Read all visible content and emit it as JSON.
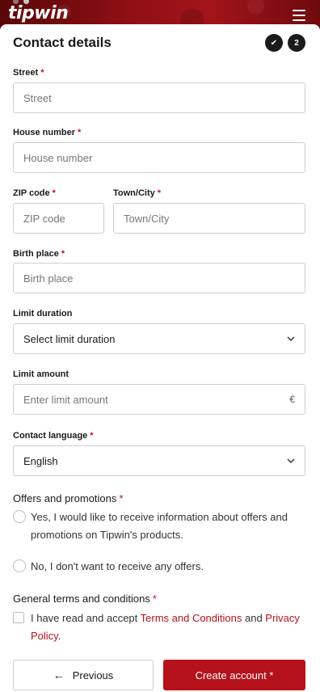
{
  "header": {
    "logo": "tipwin",
    "menu_icon": "hamburger-menu-icon"
  },
  "form": {
    "title": "Contact details",
    "steps": [
      "✔",
      "2"
    ],
    "street": {
      "label": "Street",
      "required": "*",
      "placeholder": "Street"
    },
    "house_number": {
      "label": "House number",
      "required": "*",
      "placeholder": "House number"
    },
    "zip": {
      "label": "ZIP code",
      "required": "*",
      "placeholder": "ZIP code"
    },
    "city": {
      "label": "Town/City",
      "required": "*",
      "placeholder": "Town/City"
    },
    "birth_place": {
      "label": "Birth place",
      "required": "*",
      "placeholder": "Birth place"
    },
    "limit_duration": {
      "label": "Limit duration",
      "value": "Select limit duration"
    },
    "limit_amount": {
      "label": "Limit amount",
      "placeholder": "Enter limit amount",
      "currency": "€"
    },
    "contact_language": {
      "label": "Contact language",
      "required": "*",
      "value": "English"
    },
    "offers": {
      "label": "Offers and promotions",
      "required": "*",
      "option_yes": "Yes, I would like to receive information about offers and promotions on Tipwin's products.",
      "option_no": "No, I don't want to receive any offers."
    },
    "terms": {
      "label": "General terms and conditions",
      "required": "*",
      "text_before": "I have read and accept ",
      "link_terms": "Terms and Conditions",
      "text_and": " and ",
      "link_privacy": "Privacy Policy",
      "text_after": "."
    },
    "buttons": {
      "previous": "Previous",
      "previous_icon": "←",
      "create": "Create account *"
    }
  },
  "colors": {
    "accent": "#b5121b",
    "header": "#8e0f14"
  }
}
